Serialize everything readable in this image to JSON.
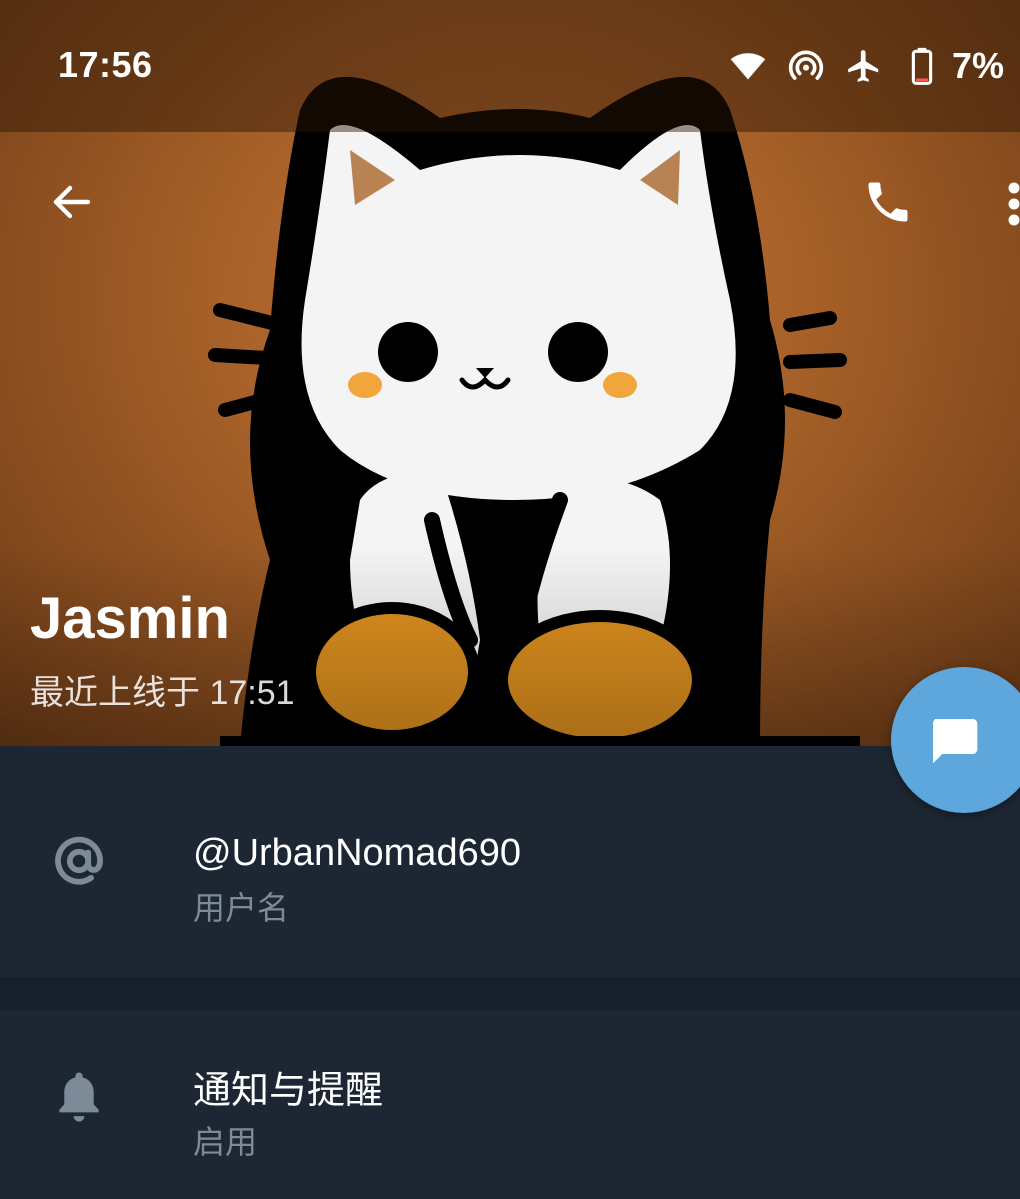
{
  "status_bar": {
    "time": "17:56",
    "battery": "7%",
    "icons": [
      "wifi-icon",
      "hotspot-icon",
      "airplane-icon",
      "battery-icon"
    ]
  },
  "toolbar": {
    "back_icon": "arrow-left-icon",
    "call_icon": "phone-icon",
    "more_icon": "more-vertical-icon"
  },
  "profile": {
    "name": "Jasmin",
    "last_seen": "最近上线于 17:51"
  },
  "fab": {
    "icon": "message-icon"
  },
  "info": {
    "username": {
      "value": "@UrbanNomad690",
      "label": "用户名",
      "icon": "at-sign-icon"
    },
    "notifications": {
      "title": "通知与提醒",
      "value": "启用",
      "icon": "bell-icon"
    }
  },
  "colors": {
    "background": "#1d2733",
    "divider": "#16202a",
    "accent": "#5ea7dc",
    "secondary_text": "#7d8b99",
    "icon_gray": "#7d8b99"
  }
}
